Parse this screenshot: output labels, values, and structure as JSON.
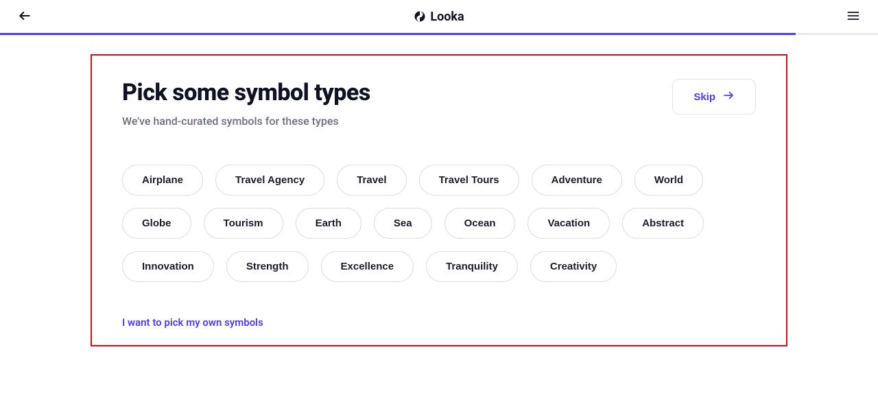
{
  "header": {
    "brand": "Looka"
  },
  "progress": {
    "percent": 90.6
  },
  "page": {
    "title": "Pick some symbol types",
    "subtitle": "We've hand-curated symbols for these types",
    "skip_label": "Skip",
    "own_symbols_label": "I want to pick my own symbols"
  },
  "chips": [
    "Airplane",
    "Travel Agency",
    "Travel",
    "Travel Tours",
    "Adventure",
    "World",
    "Globe",
    "Tourism",
    "Earth",
    "Sea",
    "Ocean",
    "Vacation",
    "Abstract",
    "Innovation",
    "Strength",
    "Excellence",
    "Tranquility",
    "Creativity"
  ],
  "colors": {
    "accent": "#4a3aff",
    "highlight_border": "#e30613"
  }
}
